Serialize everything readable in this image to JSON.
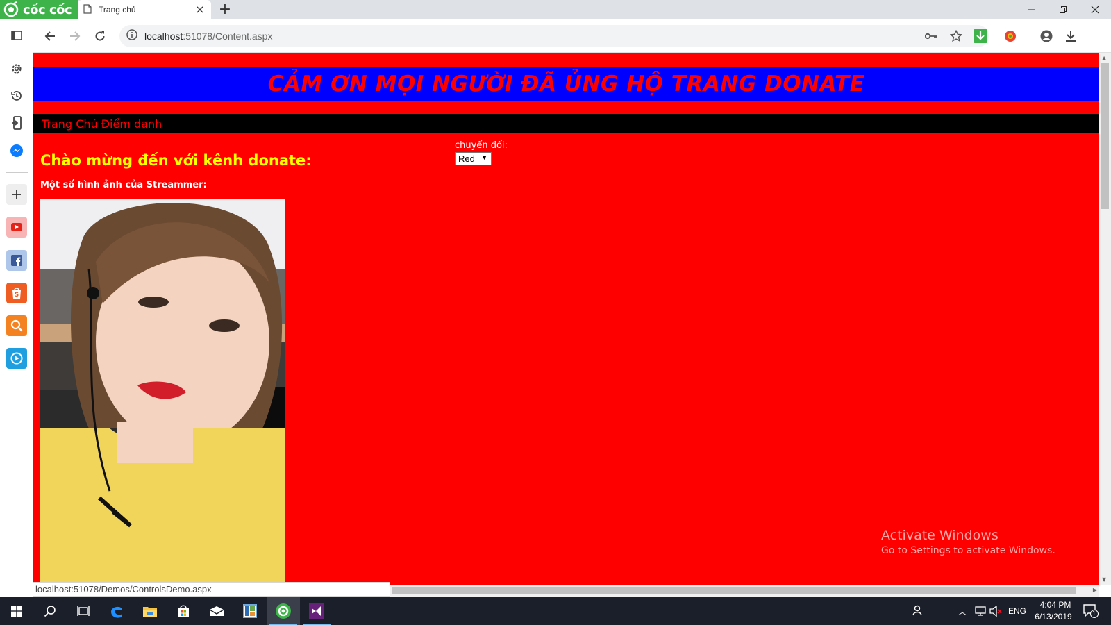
{
  "browser": {
    "brand": "cốc cốc",
    "tab_title": "Trang chủ",
    "address": "localhost:51078/Content.aspx",
    "address_host": "localhost",
    "address_rest": ":51078/Content.aspx",
    "status_url": "localhost:51078/Demos/ControlsDemo.aspx"
  },
  "page": {
    "banner": "CẢM ƠN MỌI NGƯỜI ĐÃ ỦNG HỘ TRANG DONATE",
    "menu": [
      "Trang Chủ",
      "Điểm danh"
    ],
    "welcome": "Chào mừng đến với kênh donate:",
    "subtitle": "Một số hình ảnh của Streammer:",
    "switch_label": "chuyển đổi:",
    "switch_value": "Red",
    "background_color": "#ff0000",
    "banner_color": "#0000ff"
  },
  "watermark": {
    "line1": "Activate Windows",
    "line2": "Go to Settings to activate Windows."
  },
  "taskbar": {
    "language": "ENG",
    "time": "4:04 PM",
    "date": "6/13/2019",
    "notification_count": "1"
  }
}
